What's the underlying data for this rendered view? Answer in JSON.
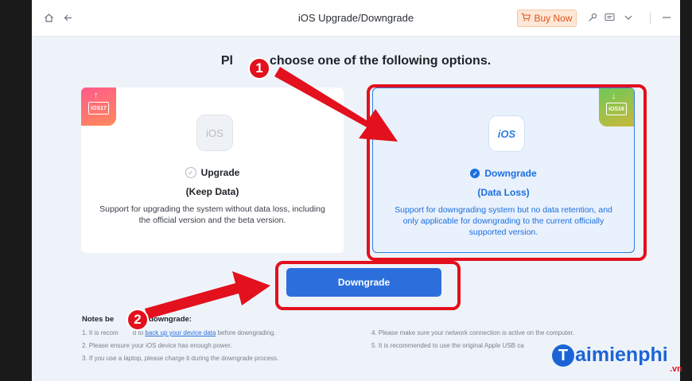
{
  "window": {
    "title": "iOS Upgrade/Downgrade",
    "buy_now_label": "Buy Now",
    "icons": [
      "home-icon",
      "back-arrow-icon",
      "cart-icon",
      "key-icon",
      "feedback-icon",
      "chevron-down-icon",
      "minimize-icon"
    ]
  },
  "heading": {
    "before_marker": "Pl",
    "after_marker": "choose one of the following options."
  },
  "options": [
    {
      "ribbon": "iOS17",
      "icon_text": "iOS",
      "title": "Upgrade",
      "subtitle": "(Keep Data)",
      "description": "Support for upgrading the system without data loss, including the official version and the beta version.",
      "selected": false
    },
    {
      "ribbon": "iOS16",
      "icon_text": "iOS",
      "title": "Downgrade",
      "subtitle": "(Data Loss)",
      "description": "Support for downgrading system but no data retention, and only applicable for downgrading to the current officially supported version.",
      "selected": true
    }
  ],
  "action_button_label": "Downgrade",
  "notes": {
    "title_start": "Notes be",
    "title_end": "downgrade:",
    "note1_prefix": "1. It is recom",
    "note1_mid": "d to",
    "note1_link": "back up your device data",
    "note1_suffix": "before downgrading.",
    "note2": "2. Please ensure your iOS device has enough power.",
    "note3": "3. If you use a laptop, please charge it during the downgrade process.",
    "note4": "4. Please make sure your network connection is active on the computer.",
    "note5": "5. It is recommended to use the original Apple USB ca"
  },
  "markers": [
    "1",
    "2"
  ],
  "watermark": {
    "letter": "T",
    "text": "aimienphi",
    "suffix": ".vn"
  },
  "colors": {
    "accent": "#2c6fdc",
    "highlight": "#e3101d",
    "buy_now": "#e0531e"
  }
}
